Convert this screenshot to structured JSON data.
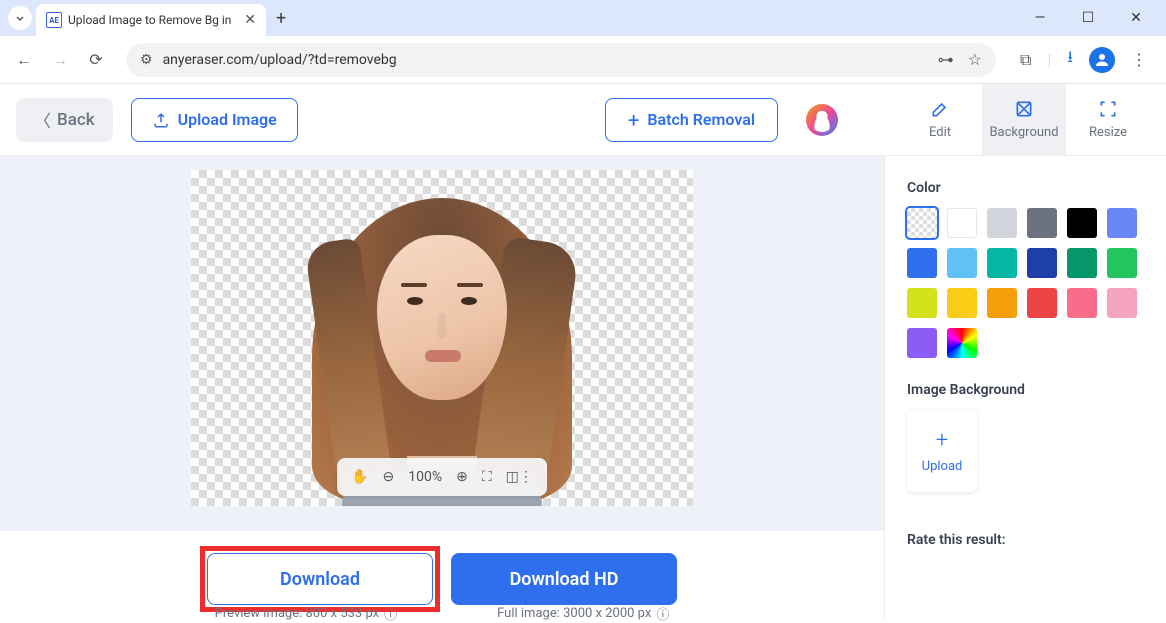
{
  "browser": {
    "tab_favicon": "AE",
    "tab_title": "Upload Image to Remove Bg in",
    "url": "anyeraser.com/upload/?td=removebg"
  },
  "header": {
    "back": "Back",
    "upload": "Upload Image",
    "batch": "Batch Removal",
    "tool_edit": "Edit",
    "tool_background": "Background",
    "tool_resize": "Resize"
  },
  "zoom": {
    "value": "100%"
  },
  "downloads": {
    "download": "Download",
    "download_hd": "Download HD",
    "preview_info": "Preview image: 800 x 533 px",
    "full_info": "Full image: 3000 x 2000 px"
  },
  "panel": {
    "color_title": "Color",
    "image_bg_title": "Image Background",
    "upload_label": "Upload",
    "rate_title": "Rate this result:",
    "colors": [
      "#ffffff",
      "#d1d5db",
      "#6b7280",
      "#000000",
      "#6a87f5",
      "#2f6fed",
      "#60c1f7",
      "#06b6a4",
      "#1e3fa8",
      "#059669",
      "#22c55e",
      "#d4e21b",
      "#facc15",
      "#f59e0b",
      "#ef4444",
      "#f96c8a",
      "#f5a3c1",
      "#8b5cf6"
    ]
  }
}
